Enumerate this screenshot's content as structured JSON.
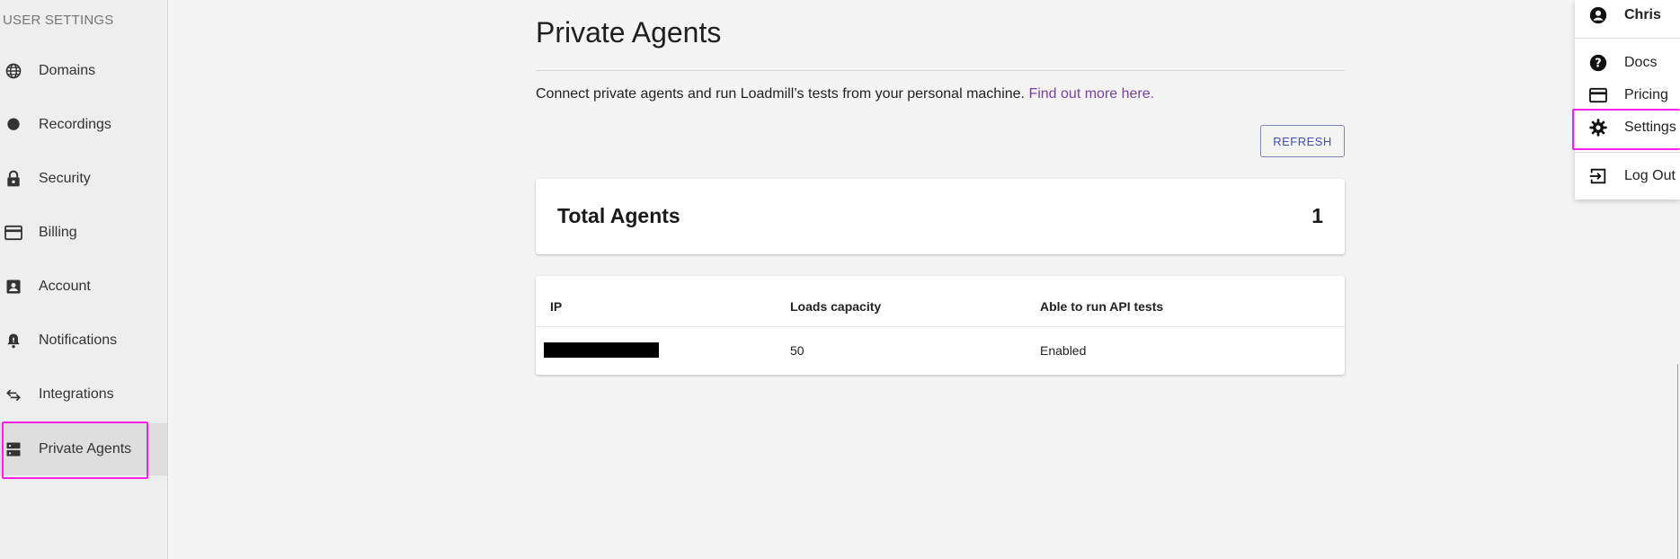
{
  "sidebar": {
    "title": "USER SETTINGS",
    "items": [
      {
        "label": "Domains",
        "icon": "globe-icon"
      },
      {
        "label": "Recordings",
        "icon": "record-icon"
      },
      {
        "label": "Security",
        "icon": "lock-icon"
      },
      {
        "label": "Billing",
        "icon": "credit-card-icon"
      },
      {
        "label": "Account",
        "icon": "account-box-icon"
      },
      {
        "label": "Notifications",
        "icon": "bell-icon"
      },
      {
        "label": "Integrations",
        "icon": "swap-arrows-icon"
      },
      {
        "label": "Private Agents",
        "icon": "server-icon",
        "active": true
      }
    ]
  },
  "main": {
    "title": "Private Agents",
    "description": "Connect private agents and run Loadmill’s tests from your personal machine.",
    "description_link": "Find out more here.",
    "refresh_label": "REFRESH",
    "total": {
      "label": "Total Agents",
      "value": "1"
    },
    "table": {
      "headers": [
        "IP",
        "Loads capacity",
        "Able to run API tests"
      ],
      "rows": [
        {
          "ip": "[redacted]",
          "capacity": "50",
          "api_tests": "Enabled"
        }
      ]
    }
  },
  "user_menu": {
    "user_name": "Chris",
    "items": [
      {
        "label": "Docs",
        "icon": "help-circle-icon"
      },
      {
        "label": "Pricing",
        "icon": "credit-card-icon"
      },
      {
        "label": "Settings",
        "icon": "gear-icon"
      },
      {
        "label": "Log Out",
        "icon": "logout-icon"
      }
    ]
  },
  "colors": {
    "accent": "#3f51b5",
    "link": "#7b3fa0",
    "highlight": "#ff1ee8"
  }
}
